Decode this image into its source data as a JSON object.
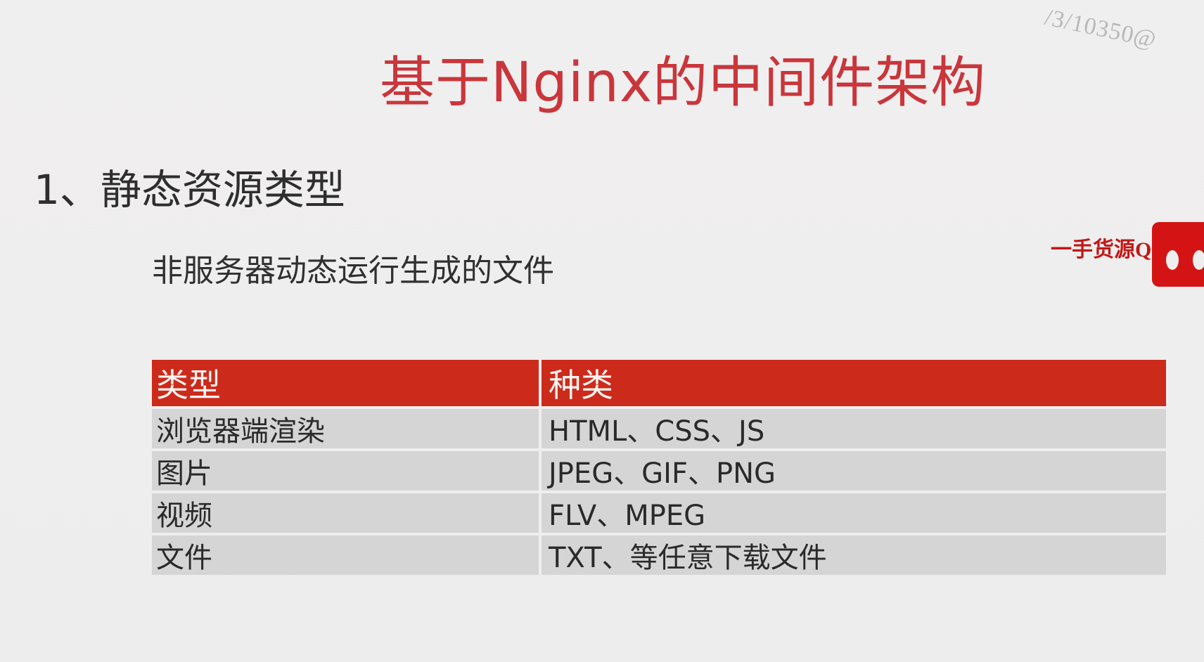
{
  "watermark": {
    "text": "/3/10350@"
  },
  "slide": {
    "title": "基于Nginx的中间件架构",
    "heading": "1、静态资源类型",
    "subtext": "非服务器动态运行生成的文件"
  },
  "stamp": {
    "text": "一手货源Q"
  },
  "table": {
    "headers": {
      "type": "类型",
      "kind": "种类"
    },
    "rows": [
      {
        "type": "浏览器端渲染",
        "kind": "HTML、CSS、JS"
      },
      {
        "type": "图片",
        "kind": "JPEG、GIF、PNG"
      },
      {
        "type": "视频",
        "kind": "FLV、MPEG"
      },
      {
        "type": "文件",
        "kind": "TXT、等任意下载文件"
      }
    ]
  },
  "colors": {
    "title": "#c9363b",
    "header_bg": "#cc2a1a",
    "row_bg": "#d6d5d5",
    "background": "#efeeee",
    "stamp": "#d41414"
  }
}
